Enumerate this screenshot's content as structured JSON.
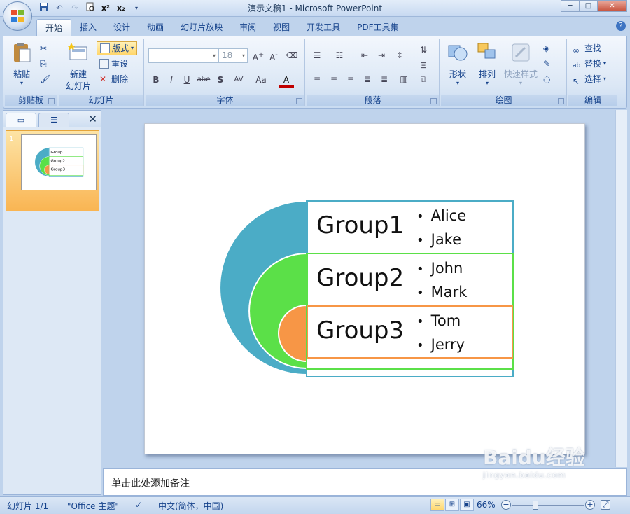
{
  "window": {
    "title": "演示文稿1 - Microsoft PowerPoint"
  },
  "qat": {
    "undo": "↶",
    "redo": "↷",
    "superscript": "x²",
    "subscript": "x₂"
  },
  "tabs": [
    {
      "label": "开始"
    },
    {
      "label": "插入"
    },
    {
      "label": "设计"
    },
    {
      "label": "动画"
    },
    {
      "label": "幻灯片放映"
    },
    {
      "label": "审阅"
    },
    {
      "label": "视图"
    },
    {
      "label": "开发工具"
    },
    {
      "label": "PDF工具集"
    }
  ],
  "ribbon": {
    "clipboard": {
      "label": "剪贴板",
      "paste": "粘贴"
    },
    "slides": {
      "label": "幻灯片",
      "new_slide_1": "新建",
      "new_slide_2": "幻灯片",
      "layout": "版式",
      "reset": "重设",
      "delete": "删除"
    },
    "font": {
      "label": "字体",
      "font_name": "",
      "font_size": "18"
    },
    "paragraph": {
      "label": "段落"
    },
    "drawing": {
      "label": "绘图",
      "shapes": "形状",
      "arrange": "排列",
      "quick_styles": "快速样式"
    },
    "editing": {
      "label": "编辑",
      "find": "查找",
      "replace": "替换",
      "select": "选择"
    }
  },
  "slide_panel": {
    "slide_number": "1"
  },
  "slide": {
    "groups": [
      {
        "name": "Group1",
        "members": [
          "Alice",
          "Jake"
        ],
        "color": "#4bacc6"
      },
      {
        "name": "Group2",
        "members": [
          "John",
          "Mark"
        ],
        "color": "#5be048"
      },
      {
        "name": "Group3",
        "members": [
          "Tom",
          "Jerry"
        ],
        "color": "#f79646"
      }
    ]
  },
  "notes": {
    "placeholder": "单击此处添加备注"
  },
  "status": {
    "slide_info": "幻灯片 1/1",
    "theme": "\"Office 主题\"",
    "language": "中文(简体，中国)",
    "zoom": "66%"
  },
  "watermark": {
    "brand": "Baidu经验",
    "url": "jingyan.baidu.com"
  }
}
